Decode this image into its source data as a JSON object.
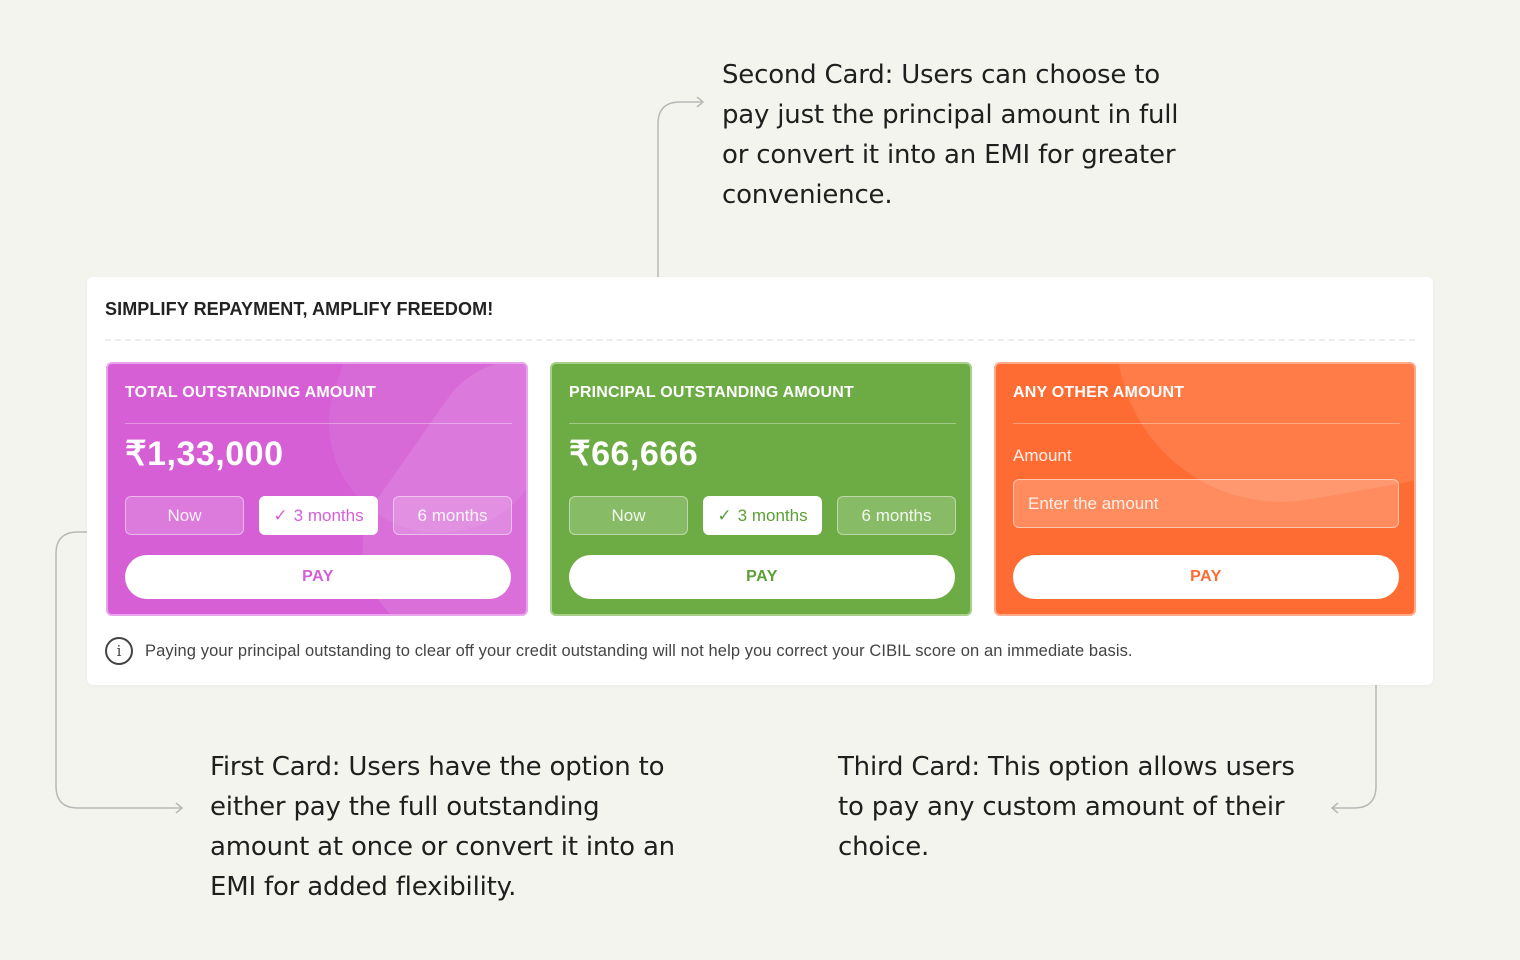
{
  "annotations": {
    "second_card": "Second Card: Users can choose to pay just the principal amount in full or convert it into an EMI for greater convenience.",
    "first_card": "First Card: Users have the option to either pay the full outstanding amount at once or convert it into an EMI for added flexibility.",
    "third_card": "Third Card: This option allows users to pay any custom amount of their choice."
  },
  "panel": {
    "title": "SIMPLIFY REPAYMENT, AMPLIFY FREEDOM!",
    "info_icon": "info-icon",
    "info_text": "Paying your principal outstanding to clear off your credit outstanding will not help you correct your CIBIL score on an immediate basis."
  },
  "cards": [
    {
      "title": "TOTAL OUTSTANDING AMOUNT",
      "amount": "₹1,33,000",
      "color": "#d65fd6",
      "options": [
        "Now",
        "3 months",
        "6 months"
      ],
      "selected_option": "3 months",
      "check_icon": "checkmark-icon",
      "pay_label": "PAY"
    },
    {
      "title": "PRINCIPAL OUTSTANDING AMOUNT",
      "amount": "₹66,666",
      "color": "#6dac44",
      "options": [
        "Now",
        "3 months",
        "6 months"
      ],
      "selected_option": "3 months",
      "check_icon": "checkmark-icon",
      "pay_label": "PAY"
    },
    {
      "title": "ANY OTHER AMOUNT",
      "color": "#ff6c33",
      "field_label": "Amount",
      "input_value": "",
      "input_placeholder": "Enter the amount",
      "pay_label": "PAY"
    }
  ]
}
